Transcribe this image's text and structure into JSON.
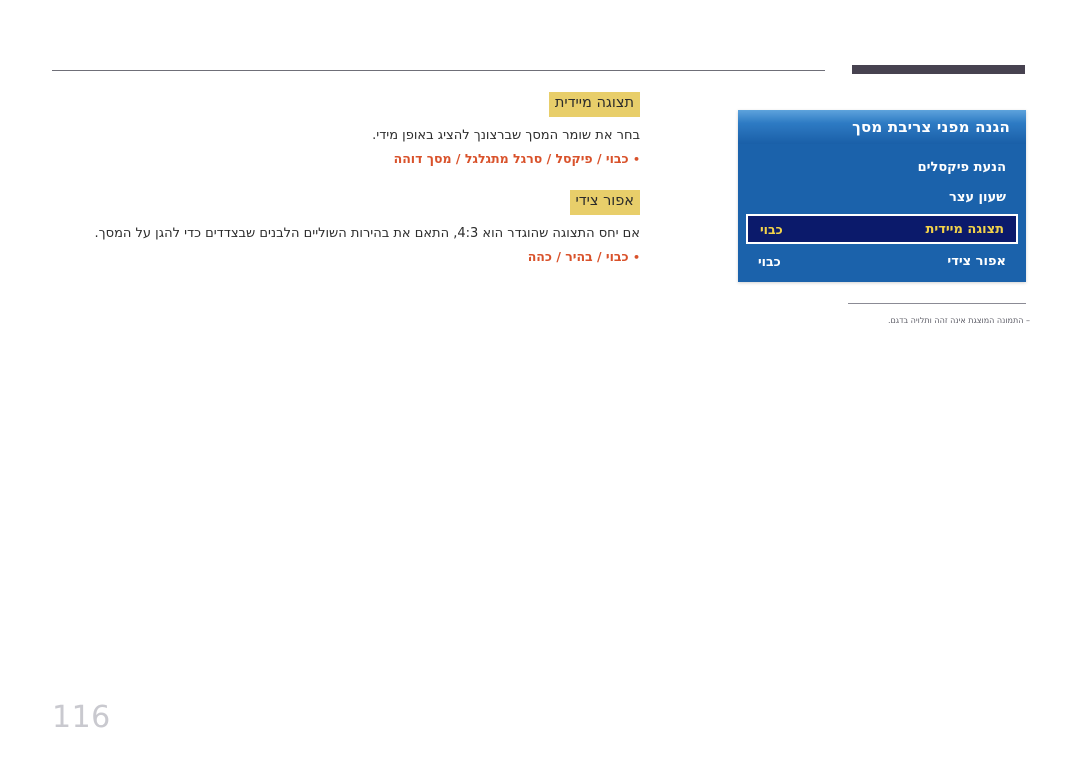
{
  "page": {
    "number": "116"
  },
  "sections": [
    {
      "heading": "תצוגה מיידית",
      "paragraph": "בחר את שומר המסך שברצונך להציג באופן מידי.",
      "bullet": "•",
      "options": "כבוי / פיקסל / סרגל מתגלגל / מסך דוהה"
    },
    {
      "heading": "אפור צידי",
      "paragraph": "אם יחס התצוגה שהוגדר הוא 4:3, התאם את בהירות השוליים הלבנים שבצדדים כדי להגן על המסך.",
      "bullet": "•",
      "options": "כבוי / בהיר / כהה"
    }
  ],
  "osd": {
    "title": "הגנה מפני צריבת מסך",
    "rows": [
      {
        "label": "הנעת פיקסלים",
        "value": "",
        "selected": false
      },
      {
        "label": "שעון עצר",
        "value": "",
        "selected": false
      },
      {
        "label": "תצוגה מיידית",
        "value": "כבוי",
        "selected": true
      },
      {
        "label": "אפור צידי",
        "value": "כבוי",
        "selected": false
      }
    ]
  },
  "footnote": {
    "text": "–  התמונה המוצגת אינה זהה ותלויה בדגם."
  },
  "colors": {
    "osd_background": "#1b62ab",
    "osd_selected_background": "#0b1a6b",
    "osd_selected_text": "#f3d34a",
    "heading_highlight": "#e8ce6a",
    "option_text": "#d9522b",
    "rule_thick": "#474250",
    "page_number": "#c9c9cf"
  }
}
